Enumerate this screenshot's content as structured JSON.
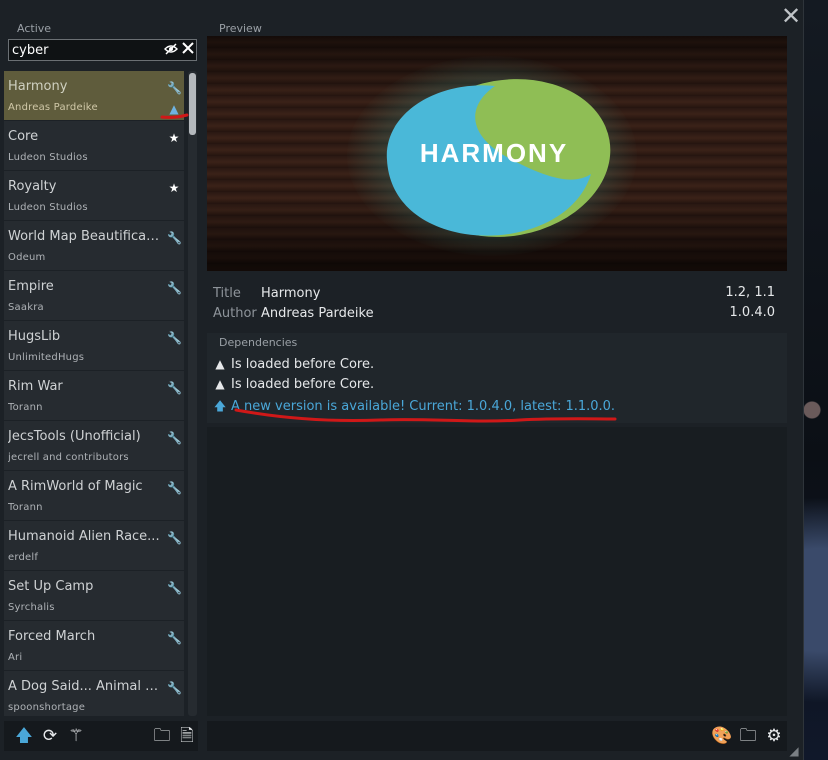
{
  "window": {
    "close_glyph": "✕",
    "active_label": "Active",
    "preview_label": "Preview"
  },
  "search": {
    "value": "cyber",
    "toggle_icon": "eye-off-icon",
    "clear_icon": "close-icon"
  },
  "mods": [
    {
      "name": "Harmony",
      "author": "Andreas Pardeike",
      "icon": "steam-icon",
      "selected": true,
      "warning": true
    },
    {
      "name": "Core",
      "author": "Ludeon Studios",
      "icon": "star-icon"
    },
    {
      "name": "Royalty",
      "author": "Ludeon Studios",
      "icon": "star-icon"
    },
    {
      "name": "World Map Beautificati...",
      "author": "Odeum",
      "icon": "steam-icon"
    },
    {
      "name": "Empire",
      "author": "Saakra",
      "icon": "steam-icon"
    },
    {
      "name": "HugsLib",
      "author": "UnlimitedHugs",
      "icon": "steam-icon"
    },
    {
      "name": "Rim War",
      "author": "Torann",
      "icon": "steam-icon"
    },
    {
      "name": "JecsTools (Unofficial)",
      "author": "jecrell and contributors",
      "icon": "steam-icon"
    },
    {
      "name": "A RimWorld of Magic",
      "author": "Torann",
      "icon": "steam-icon"
    },
    {
      "name": "Humanoid Alien Race...",
      "author": "erdelf",
      "icon": "steam-icon"
    },
    {
      "name": "Set Up Camp",
      "author": "Syrchalis",
      "icon": "steam-icon"
    },
    {
      "name": "Forced March",
      "author": "Ari",
      "icon": "steam-icon"
    },
    {
      "name": "A Dog Said... Animal P...",
      "author": "spoonshortage",
      "icon": "steam-icon"
    }
  ],
  "preview": {
    "logo_text": "HARMONY",
    "logo_colors": {
      "blue": "#4ab8d8",
      "green": "#8fbe55"
    }
  },
  "details": {
    "title_label": "Title",
    "title_value": "Harmony",
    "author_label": "Author",
    "author_value": "Andreas Pardeike",
    "versions": "1.2, 1.1",
    "mod_version": "1.0.4.0"
  },
  "dependencies": {
    "title": "Dependencies",
    "rows": [
      {
        "icon": "warning-icon",
        "text": "Is loaded before Core."
      },
      {
        "icon": "warning-icon",
        "text": "Is loaded before Core."
      },
      {
        "icon": "arrow-up-icon",
        "text": "A new version is available! Current: 1.0.4.0, latest: 1.1.0.0."
      }
    ]
  },
  "toolbar_left": [
    {
      "icon": "arrow-up-icon",
      "color": "#4aa7d8"
    },
    {
      "icon": "refresh-icon"
    },
    {
      "icon": "magic-wand-icon"
    },
    {
      "icon": "new-folder-icon"
    },
    {
      "icon": "document-icon"
    }
  ],
  "toolbar_right": [
    {
      "icon": "palette-icon"
    },
    {
      "icon": "new-folder-icon"
    },
    {
      "icon": "steam-settings-icon"
    }
  ],
  "colors": {
    "accent_blue": "#4aa7d8",
    "selected_row": "#5f5c3c",
    "annotation_red": "#d01818"
  }
}
